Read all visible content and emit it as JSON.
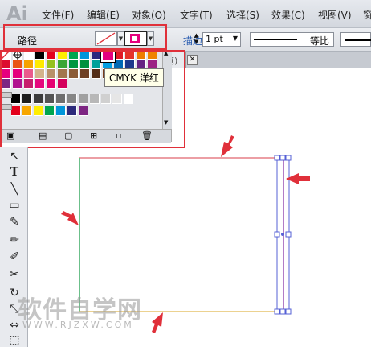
{
  "app": {
    "logo": "Ai"
  },
  "menubar": {
    "items": [
      "文件(F)",
      "编辑(E)",
      "对象(O)",
      "文字(T)",
      "选择(S)",
      "效果(C)",
      "视图(V)",
      "窗"
    ]
  },
  "controlbar": {
    "object_label": "路径",
    "stroke_label": "描边:",
    "stroke_weight": "1 pt",
    "profile_label": "等比"
  },
  "swatches": {
    "tooltip": "CMYK 洋红",
    "rows": [
      [
        "none",
        "reg",
        "#ffffff",
        "#000000",
        "#e3001b",
        "#ffed00",
        "#00a550",
        "#0095da",
        "#29297f",
        "#e4007f",
        "#e01a26",
        "#e5332a",
        "#ee7d00",
        "#f08300"
      ],
      [
        "#dd0d2f",
        "#e95513",
        "#f5a300",
        "#ffea00",
        "#95c11f",
        "#3aa635",
        "#009640",
        "#00923f",
        "#00a19a",
        "#009fe3",
        "#0069b4",
        "#1d388b",
        "#662383",
        "#9c2284"
      ],
      [
        "#e6007e",
        "#e5007d",
        "#ea5a8c",
        "#d3b38c",
        "#b8906a",
        "#a2754e",
        "#8c5c37",
        "#6f4125",
        "#532e18",
        "#7a3d1c",
        "#582b14",
        "#3d1f0f",
        "#8f9ba3",
        "#5b6770"
      ],
      [
        "#7d2683",
        "#b1128f",
        "#c71d6d",
        "#e5087e",
        "#e60072",
        "#d4005c"
      ]
    ],
    "gray_row": [
      "#000000",
      "#1e1e1e",
      "#3c3c3c",
      "#545454",
      "#6e6e6e",
      "#868686",
      "#a0a0a0",
      "#b8b8b8",
      "#d0d0d0",
      "#e6e6e6",
      "#ffffff"
    ],
    "bright_row": [
      "#e3001b",
      "#f7a600",
      "#ffed00",
      "#00a550",
      "#0095da",
      "#2c2a7b",
      "#7d2683"
    ]
  },
  "watermark": {
    "cn": "软件自学网",
    "en": "WWW.RJZXW.COM"
  },
  "colors": {
    "accent_red": "#e0303a",
    "rect_top": "#e57f86",
    "rect_left": "#6cc08b",
    "rect_bottom": "#e6c46c",
    "selection": "#5560d6"
  },
  "icons": [
    "selection-tool-icon",
    "type-tool-icon",
    "line-tool-icon",
    "rectangle-tool-icon",
    "paintbrush-tool-icon",
    "pencil-tool-icon",
    "blob-brush-icon",
    "scissors-tool-icon",
    "rotate-tool-icon",
    "scale-tool-icon",
    "width-tool-icon",
    "free-transform-icon"
  ]
}
